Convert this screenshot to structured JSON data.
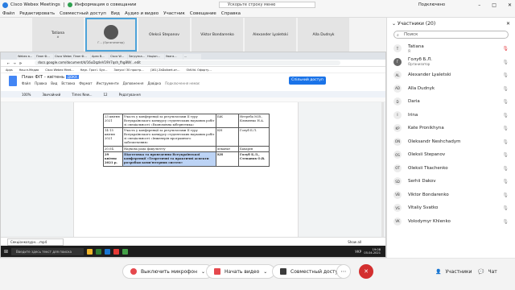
{
  "window": {
    "app_name": "Cisco Webex Meetings",
    "info_label": "Информация о совещании",
    "search_placeholder": "Ускорьте строку меню",
    "status": "Подключено"
  },
  "menubar": [
    "Файл",
    "Редактировать",
    "Совместный доступ",
    "Вид",
    "Аудио и видео",
    "Участник",
    "Совещание",
    "Справка"
  ],
  "thumbs": [
    {
      "name": "Tatiana",
      "sub": "#"
    },
    {
      "name": "Г... (Организатор)",
      "sub": ""
    },
    {
      "name": "Oleksii Stepanov",
      "sub": ""
    },
    {
      "name": "Viktor Bondarenko",
      "sub": ""
    },
    {
      "name": "Alexander Lyaletski",
      "sub": ""
    },
    {
      "name": "Alla Dudnyk",
      "sub": ""
    }
  ],
  "browser": {
    "tabs": [
      "Webex в...",
      "План Ф...",
      "Cisco Webex Meet...",
      "План Ф...",
      "Apex В...",
      "Cisco W...",
      "Загрузка...",
      "Нацiон...",
      "Увага...",
      "..."
    ],
    "url": "docs.google.com/document/d/16uDqzIeV19V7qsh_fhg8W/...edit",
    "bookmarks": [
      "Apps",
      "Наш е-Медиа",
      "Cisco Webex Meet...",
      "Наук. Гроз I. Бул...",
      "Запуск! 30 простр...",
      "(161) ZaDolbert-от...",
      "OldVid. Офорту..."
    ]
  },
  "doc": {
    "title": "План ФІТ - квітень",
    "badge": "ДОКХ",
    "menus": [
      "Файл",
      "Правка",
      "Вид",
      "Вставка",
      "Формат",
      "Инструменти",
      "Доповнення",
      "Довідка",
      "Подключення немає"
    ],
    "share_button": "Спільний доступ",
    "toolbar": [
      "100%",
      "Звичайний",
      "Times New...",
      "12",
      "Редагування"
    ],
    "rows": [
      {
        "date": "23 квітня 2021",
        "event": "Участь у конференції за результатами II туру Всеукраїнського конкурсу студентських наукових робіт зі спеціальності «Економічна кібернетика»",
        "org": "БіК",
        "resp": "Нетреба М.В., Клименко Н.А.",
        "hl": false
      },
      {
        "date": "14-15 квітня 2021",
        "event": "Участь у конференції за результатами II туру Всеукраїнського конкурсу студентських наукових робіт зі спеціальності «Інженерія програмного забезпечення»",
        "org": "КН",
        "resp": "Голуб Б.Л.",
        "hl": false
      },
      {
        "date": "20.04.",
        "event": "Наукова рада факультету",
        "org": "деканат",
        "resp": "Бахарєв",
        "hl": false
      },
      {
        "date": "29 квітня 2021 р.",
        "event": "Підготовка та проведення Всеукраїнської конференції «Теоретичні та практичні аспекти розробки комп'ютерних систем»",
        "org": "КН",
        "resp": "Голуб Б.Л., Степанов О.В.",
        "hl": true
      }
    ]
  },
  "download": {
    "file": "Секціонкозурн....mp4",
    "show_all": "Show all"
  },
  "taskbar": {
    "search": "Введите здесь текст для поиска",
    "time": "19:08",
    "date": "05.04.2021",
    "lang": "УКР"
  },
  "controls": {
    "mute": "Выключить микрофон",
    "video": "Начать видео",
    "share": "Совместный доступ",
    "participants": "Участники",
    "chat": "Чат"
  },
  "panel": {
    "title": "Участники (20)",
    "search_placeholder": "Поиск",
    "participants": [
      {
        "initials": "T",
        "name": "Tatiana",
        "sub": "Я"
      },
      {
        "initials": "Г",
        "name": "Голуб Б.Л.",
        "sub": "Организатор"
      },
      {
        "initials": "AL",
        "name": "Alexander Lyaletski",
        "sub": ""
      },
      {
        "initials": "AD",
        "name": "Alla Dudnyk",
        "sub": ""
      },
      {
        "initials": "D",
        "name": "Daria",
        "sub": ""
      },
      {
        "initials": "I",
        "name": "Irina",
        "sub": ""
      },
      {
        "initials": "KP",
        "name": "Kate Pronikhyna",
        "sub": ""
      },
      {
        "initials": "ON",
        "name": "Oleksandr Neshchadym",
        "sub": ""
      },
      {
        "initials": "OS",
        "name": "Oleksii Stepanov",
        "sub": ""
      },
      {
        "initials": "OT",
        "name": "Oleksii Tkachenko",
        "sub": ""
      },
      {
        "initials": "SD",
        "name": "Serhii Dakov",
        "sub": ""
      },
      {
        "initials": "VB",
        "name": "Viktor Bondarenko",
        "sub": ""
      },
      {
        "initials": "VS",
        "name": "Vitaliy Svatko",
        "sub": ""
      },
      {
        "initials": "VK",
        "name": "Volodymyr Khlenko",
        "sub": ""
      }
    ]
  },
  "colors": {
    "accent": "#1a73e8",
    "mute_red": "#e5484d",
    "leave_red": "#d32f2f"
  }
}
